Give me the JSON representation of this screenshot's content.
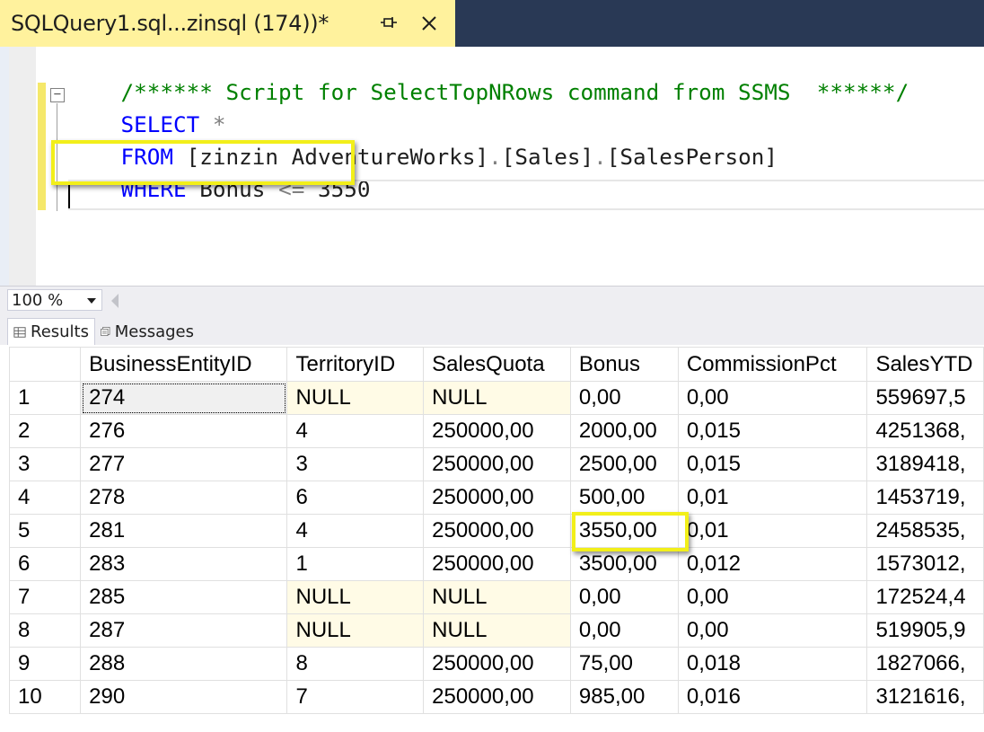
{
  "tab": {
    "title": "SQLQuery1.sql...zinsql (174))*"
  },
  "editor": {
    "line1": {
      "comment": "/****** Script for SelectTopNRows command from SSMS  ******/"
    },
    "line2": {
      "kw": "SELECT",
      "rest": " *"
    },
    "line3": {
      "kw": "FROM",
      "db": " [zinzin AdventureWorks]",
      "d1": ".",
      "schema": "[Sales]",
      "d2": ".",
      "table": "[SalesPerson]"
    },
    "line4": {
      "kw": "WHERE",
      "col": " Bonus ",
      "op": "<=",
      "val": " 3550"
    }
  },
  "zoom": {
    "value": "100 %"
  },
  "result_tabs": {
    "results": "Results",
    "messages": "Messages"
  },
  "grid": {
    "columns": [
      "",
      "BusinessEntityID",
      "TerritoryID",
      "SalesQuota",
      "Bonus",
      "CommissionPct",
      "SalesYTD"
    ],
    "rows": [
      [
        "1",
        "274",
        "NULL",
        "NULL",
        "0,00",
        "0,00",
        "559697,5"
      ],
      [
        "2",
        "276",
        "4",
        "250000,00",
        "2000,00",
        "0,015",
        "4251368,"
      ],
      [
        "3",
        "277",
        "3",
        "250000,00",
        "2500,00",
        "0,015",
        "3189418,"
      ],
      [
        "4",
        "278",
        "6",
        "250000,00",
        "500,00",
        "0,01",
        "1453719,"
      ],
      [
        "5",
        "281",
        "4",
        "250000,00",
        "3550,00",
        "0,01",
        "2458535,"
      ],
      [
        "6",
        "283",
        "1",
        "250000,00",
        "3500,00",
        "0,012",
        "1573012,"
      ],
      [
        "7",
        "285",
        "NULL",
        "NULL",
        "0,00",
        "0,00",
        "172524,4"
      ],
      [
        "8",
        "287",
        "NULL",
        "NULL",
        "0,00",
        "0,00",
        "519905,9"
      ],
      [
        "9",
        "288",
        "8",
        "250000,00",
        "75,00",
        "0,018",
        "1827066,"
      ],
      [
        "10",
        "290",
        "7",
        "250000,00",
        "985,00",
        "0,016",
        "3121616,"
      ]
    ]
  },
  "colors": {
    "tab_active": "#fff29d",
    "tabbar_bg": "#293955",
    "highlight": "#f2ef1a",
    "null_cell": "#fffbe6",
    "keyword": "#0000ff",
    "comment": "#008000"
  }
}
